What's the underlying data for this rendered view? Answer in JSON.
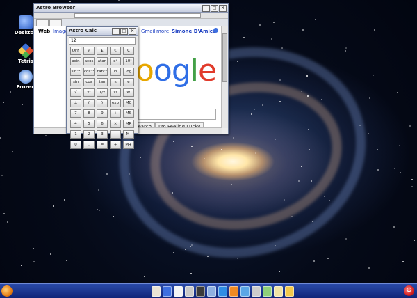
{
  "desktop": {
    "icons": [
      {
        "label": "Desktop",
        "icon": "desktop-icon",
        "color": "#3b6fd6"
      },
      {
        "label": "Tetris",
        "icon": "tetris-icon",
        "color": "#e0502e"
      },
      {
        "label": "Frozen",
        "icon": "frozen-bubble-icon",
        "color": "#7fa8e8"
      }
    ]
  },
  "browser": {
    "title": "Astro Browser",
    "nav_links": {
      "web": "Web",
      "images": "Images",
      "gmail": "Gmail",
      "more": "more",
      "user": "Simone D'Amico"
    },
    "logo_text": "oogle",
    "search_button": "Search",
    "lucky_button": "I'm Feeling Lucky"
  },
  "calculator": {
    "title": "Astro Calc",
    "display": "12",
    "keys": [
      "OFF",
      "√",
      "£",
      "€",
      "C",
      "asin",
      "acos",
      "atan",
      "eˣ",
      "10ˣ",
      "sin⁻¹",
      "cos⁻¹",
      "tan⁻¹",
      "ln",
      "log",
      "sin",
      "cos",
      "tan",
      "π",
      "e",
      "√",
      "x²",
      "1/x",
      "xʸ",
      "x!",
      "±",
      "(",
      ")",
      "exp",
      "MC",
      "7",
      "8",
      "9",
      "+",
      "MS",
      "4",
      "5",
      "6",
      "×",
      "MR",
      "1",
      "2",
      "3",
      "-",
      "M-",
      "0",
      ".",
      "=",
      "+",
      "M+"
    ]
  },
  "taskbar": {
    "power_symbol": "⏻",
    "launchers": [
      {
        "icon": "home-icon",
        "color": "#e9e3d4"
      },
      {
        "icon": "google-icon",
        "color": "#3d6fe0"
      },
      {
        "icon": "document-icon",
        "color": "#f5f5f5"
      },
      {
        "icon": "calculator-icon",
        "color": "#c9c9c9"
      },
      {
        "icon": "player-icon",
        "color": "#3a3a3a"
      },
      {
        "icon": "gear-icon",
        "color": "#8fb0e0"
      },
      {
        "icon": "globe-icon",
        "color": "#2f8de4"
      },
      {
        "icon": "rss-icon",
        "color": "#f08a24"
      },
      {
        "icon": "info-icon",
        "color": "#5aa6e6"
      },
      {
        "icon": "film-icon",
        "color": "#cccccc"
      },
      {
        "icon": "image-icon",
        "color": "#8fd07a"
      },
      {
        "icon": "mail-icon",
        "color": "#efe3a5"
      },
      {
        "icon": "folder-icon",
        "color": "#f2c94c"
      }
    ]
  }
}
